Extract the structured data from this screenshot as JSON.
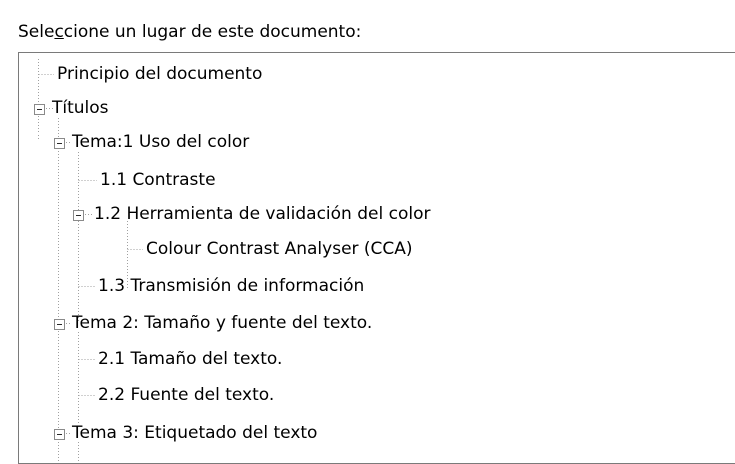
{
  "dialog": {
    "prompt_before": "Sele",
    "prompt_accel": "c",
    "prompt_after": "cione un lugar de este documento:"
  },
  "tree": {
    "items": [
      {
        "label": "Principio del documento",
        "level": 0,
        "expanded": null
      },
      {
        "label": "Títulos",
        "level": 0,
        "expanded": true
      },
      {
        "label": "Tema:1 Uso del color",
        "level": 1,
        "expanded": true
      },
      {
        "label": "1.1 Contraste",
        "level": 2,
        "expanded": null
      },
      {
        "label": "1.2 Herramienta de validación del color",
        "level": 2,
        "expanded": true
      },
      {
        "label": "Colour Contrast Analyser (CCA)",
        "level": 3,
        "expanded": null
      },
      {
        "label": "1.3 Transmisión de información",
        "level": 2,
        "expanded": null
      },
      {
        "label": "Tema 2: Tamaño y fuente del texto.",
        "level": 1,
        "expanded": true
      },
      {
        "label": "2.1 Tamaño del texto.",
        "level": 2,
        "expanded": null
      },
      {
        "label": "2.2 Fuente del texto.",
        "level": 2,
        "expanded": null
      },
      {
        "label": "Tema 3: Etiquetado del texto",
        "level": 1,
        "expanded": true
      }
    ]
  }
}
